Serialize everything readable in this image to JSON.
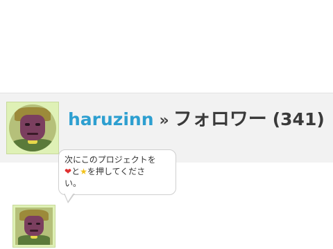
{
  "profile": {
    "username": "haruzinn",
    "separator": "»",
    "page_title": "フォロワー",
    "count": "(341)",
    "avatar_icon": "user-avatar-icon"
  },
  "message": {
    "line1": "次にこのプロジェクトを",
    "and": "と",
    "line2_rest": "を押してくださ",
    "line3": "い。",
    "heart_icon": "❤",
    "star_icon": "★",
    "colors": {
      "heart": "#e03030",
      "star": "#f2c21a"
    }
  },
  "follower": {
    "avatar_icon": "user-avatar-icon"
  },
  "colors": {
    "username": "#2d9fd0",
    "header_bg": "#f2f2f2",
    "avatar_bg": "#dff1b6"
  }
}
